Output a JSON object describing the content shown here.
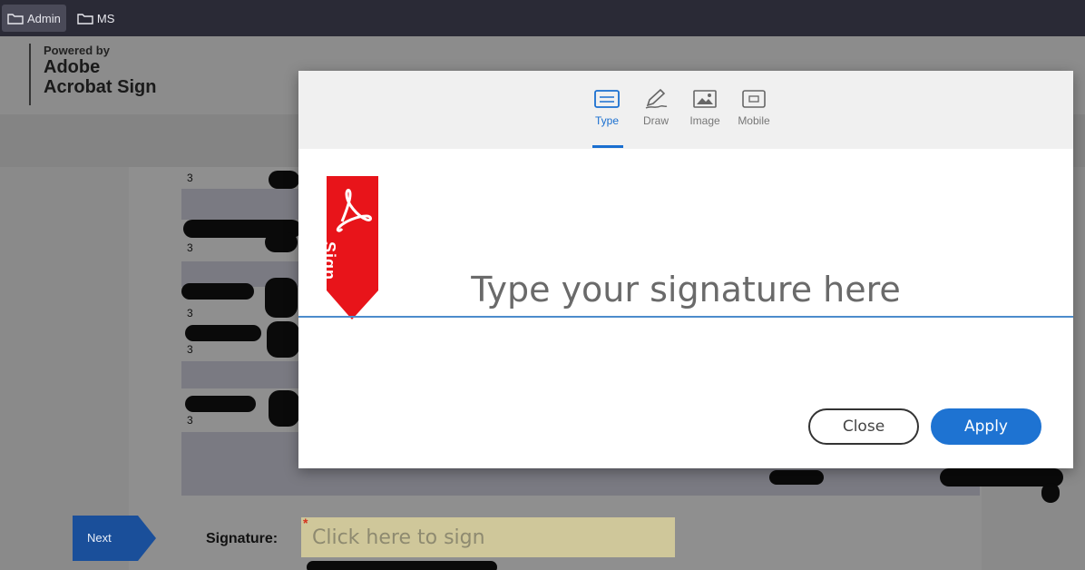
{
  "bookmarks": [
    {
      "label": "Admin",
      "icon": "folder-icon",
      "active": true
    },
    {
      "label": "MS",
      "icon": "folder-icon",
      "active": false
    }
  ],
  "brand": {
    "powered_by": "Powered by",
    "line1": "Adobe",
    "line2": "Acrobat Sign"
  },
  "document": {
    "row_numbers": [
      "3",
      "3",
      "3",
      "3",
      "3"
    ]
  },
  "dialog": {
    "tabs": [
      {
        "label": "Type",
        "icon": "keyboard-icon",
        "active": true
      },
      {
        "label": "Draw",
        "icon": "pen-icon",
        "active": false
      },
      {
        "label": "Image",
        "icon": "image-icon",
        "active": false
      },
      {
        "label": "Mobile",
        "icon": "mobile-icon",
        "active": false
      }
    ],
    "flag_label": "Sign",
    "signature_placeholder": "Type your signature here",
    "close_label": "Close",
    "apply_label": "Apply"
  },
  "footer": {
    "next_label": "Next",
    "signature_label": "Signature:",
    "signature_field": "Click here to sign",
    "required_mark": "*"
  },
  "colors": {
    "accent": "#1e73d2",
    "flag_red": "#e8141a",
    "field_yellow": "#cfc79a"
  }
}
